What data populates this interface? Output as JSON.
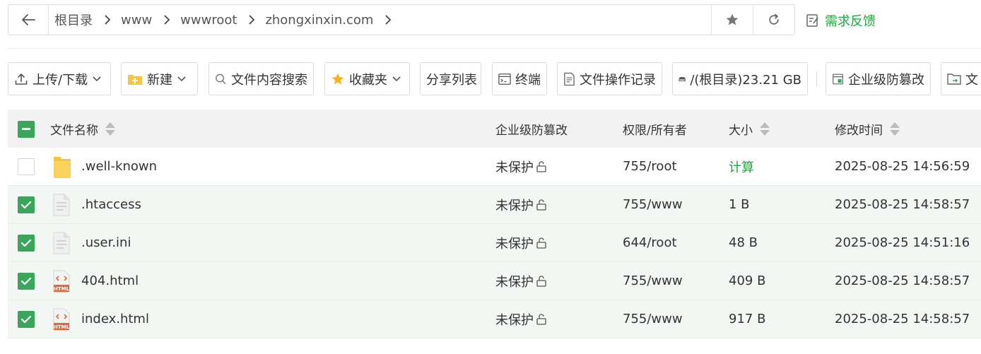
{
  "address_bar": {
    "crumbs": [
      "根目录",
      "www",
      "wwwroot",
      "zhongxinxin.com"
    ]
  },
  "feedback_label": "需求反馈",
  "toolbar": {
    "upload_label": "上传/下载",
    "new_label": "新建",
    "search_label": "文件内容搜索",
    "favorites_label": "收藏夹",
    "share_label": "分享列表",
    "terminal_label": "终端",
    "oplog_label": "文件操作记录",
    "disk_label": "/(根目录)23.21 GB",
    "tamper_label": "企业级防篡改",
    "more_label": "文"
  },
  "table": {
    "headers": {
      "name": "文件名称",
      "protect": "企业级防篡改",
      "perm": "权限/所有者",
      "size": "大小",
      "mtime": "修改时间"
    },
    "rows": [
      {
        "name": ".well-known",
        "type": "folder",
        "checked": false,
        "protect": "未保护",
        "perm": "755/root",
        "size": "计算",
        "mtime": "2025-08-25 14:56:59"
      },
      {
        "name": ".htaccess",
        "type": "text",
        "checked": true,
        "protect": "未保护",
        "perm": "755/www",
        "size": "1 B",
        "mtime": "2025-08-25 14:58:57"
      },
      {
        "name": ".user.ini",
        "type": "text",
        "checked": true,
        "protect": "未保护",
        "perm": "644/root",
        "size": "48 B",
        "mtime": "2025-08-25 14:51:16"
      },
      {
        "name": "404.html",
        "type": "html",
        "checked": true,
        "protect": "未保护",
        "perm": "755/www",
        "size": "409 B",
        "mtime": "2025-08-25 14:58:57"
      },
      {
        "name": "index.html",
        "type": "html",
        "checked": true,
        "protect": "未保护",
        "perm": "755/www",
        "size": "917 B",
        "mtime": "2025-08-25 14:58:57"
      }
    ]
  },
  "colors": {
    "accent": "#20a53a",
    "checkbox": "#3ba55c",
    "selected_row": "#f2f7f3",
    "header_bg": "#f2f2f2"
  }
}
